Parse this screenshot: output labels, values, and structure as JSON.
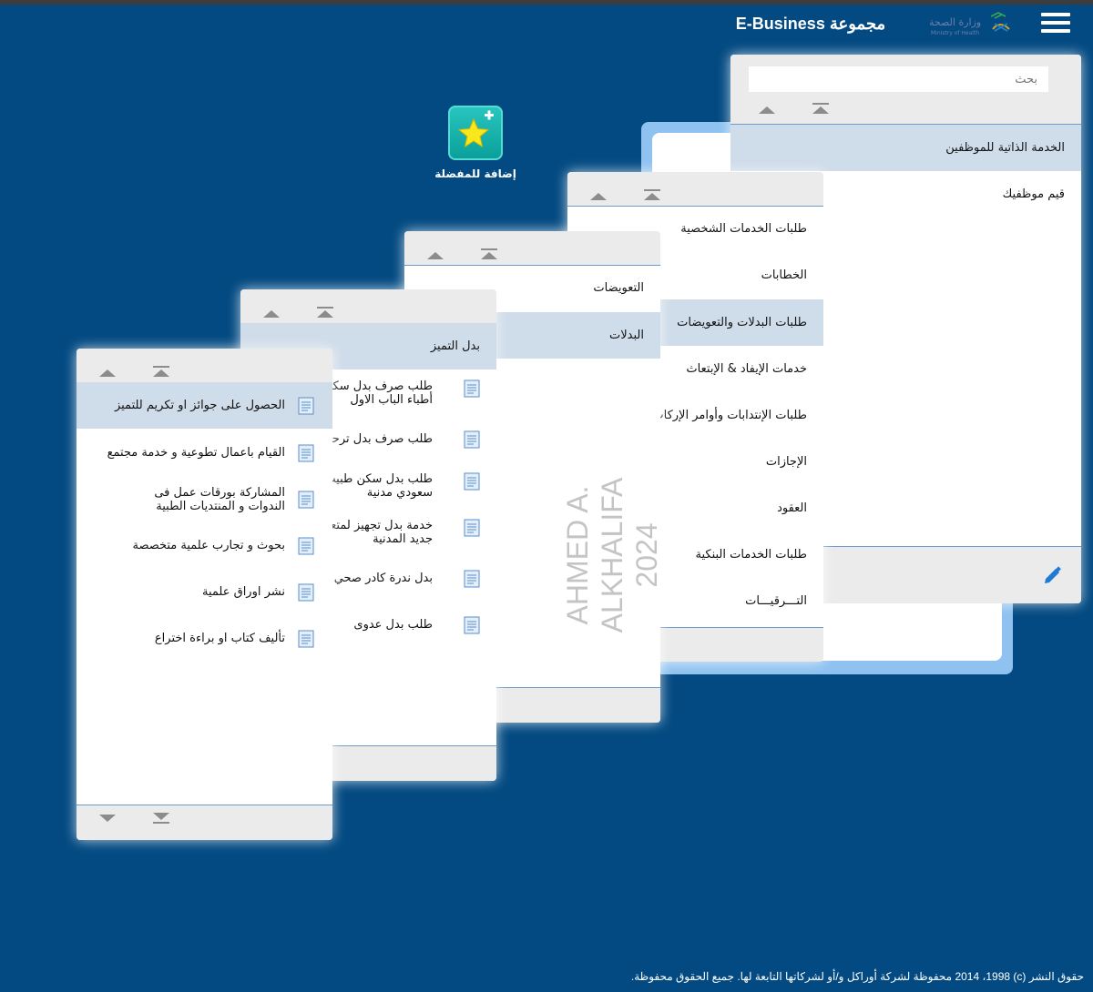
{
  "header": {
    "brand": "مجموعة E-Business",
    "menu_icon": "hamburger-icon",
    "logo_icon": "ministry-of-health-logo"
  },
  "favorites": {
    "label": "إضافة للمفضلة",
    "icon": "star-plus-icon"
  },
  "panel1": {
    "search_placeholder": "بحث",
    "items": [
      {
        "label": "الخدمة الذاتية للموظفين",
        "selected": true
      },
      {
        "label": "قيم موظفيك",
        "selected": false
      }
    ],
    "edit_icon": "pencil-icon"
  },
  "panel2": {
    "items": [
      {
        "label": "طلبات الخدمات الشخصية"
      },
      {
        "label": "الخطابات"
      },
      {
        "label": "طلبات البدلات والتعويضات"
      },
      {
        "label": "خدمات الإيفاد & الإبتعاث"
      },
      {
        "label": "طلبات الإنتدابات وأوامر الإركاب"
      },
      {
        "label": "الإجازات"
      },
      {
        "label": "العقود"
      },
      {
        "label": "طلبات الخدمات البنكية"
      },
      {
        "label": "التـــرقيـــات"
      }
    ]
  },
  "panel3": {
    "items": [
      {
        "label": "التعويضات"
      },
      {
        "label": "البدلات"
      }
    ]
  },
  "panel4": {
    "items": [
      {
        "label": "بدل التميز"
      },
      {
        "label": "طلب صرف بدل سكن أطباء الباب الاول"
      },
      {
        "label": "طلب صرف بدل ترحيل"
      },
      {
        "label": "طلب بدل سكن طبيب سعودي مدنية"
      },
      {
        "label": "خدمة بدل تجهيز لمتعاقد جديد المدنية"
      },
      {
        "label": "بدل ندرة كادر صحي سعودي"
      },
      {
        "label": "طلب بدل عدوى"
      }
    ]
  },
  "panel5": {
    "items": [
      {
        "label": "الحصول على جوائز او تكريم للتميز"
      },
      {
        "label": "القيام باعمال تطوعية و خدمة مجتمع"
      },
      {
        "label": "المشاركة بورقات عمل فى الندوات و المنتديات الطبية"
      },
      {
        "label": "بحوث و تجارب علمية متخصصة"
      },
      {
        "label": "نشر اوراق علمية"
      },
      {
        "label": "تأليف كتاب او براءة اختراع"
      }
    ]
  },
  "watermark": {
    "name": "AHMED A. ALKHALIFA",
    "year": "2024"
  },
  "footer": {
    "copyright": "حقوق النشر (c) 2014 ،1998 محفوظة لشركة أوراكل و/أو لشركاتها التابعة لها. جميع الحقوق محفوظة."
  }
}
